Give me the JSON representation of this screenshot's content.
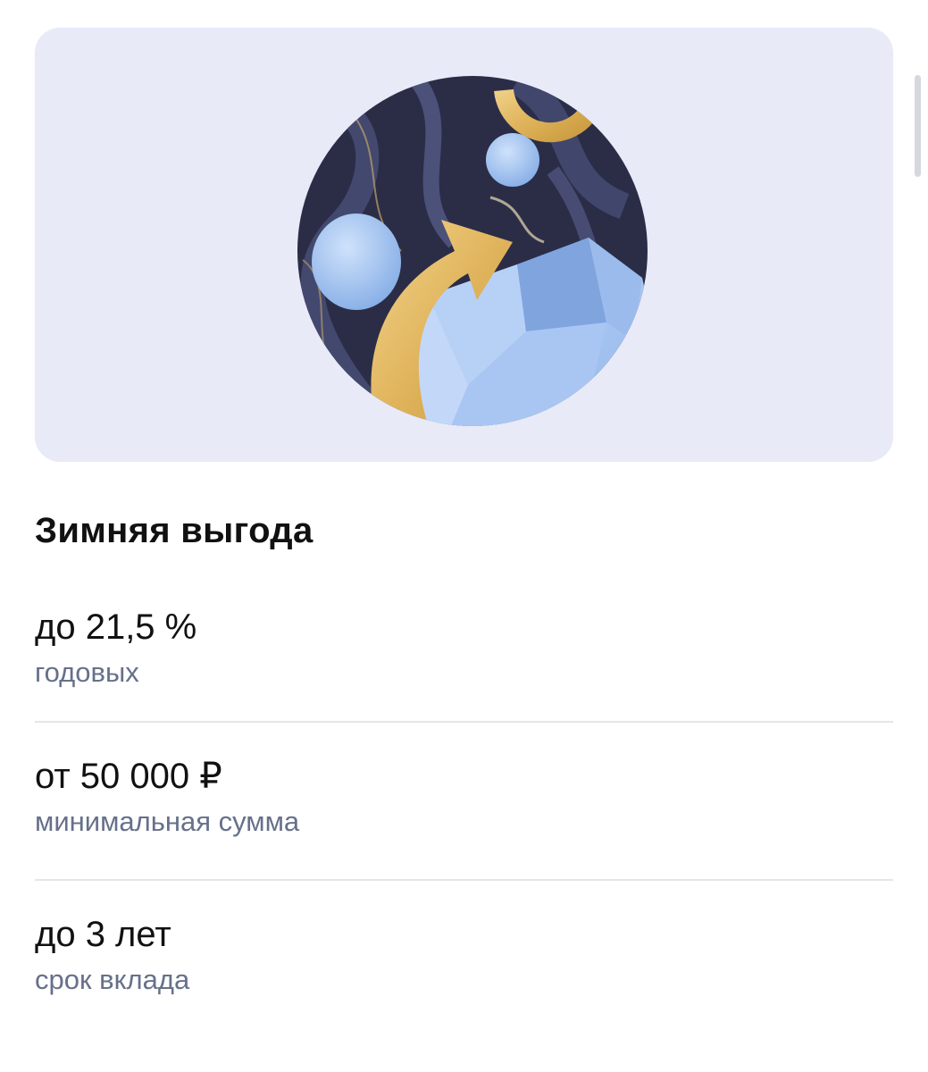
{
  "deposit": {
    "title": "Зимняя выгода",
    "params": [
      {
        "value": "до 21,5 %",
        "caption": "годовых"
      },
      {
        "value": "от 50 000 ₽",
        "caption": "минимальная сумма"
      },
      {
        "value": "до 3 лет",
        "caption": "срок вклада"
      }
    ]
  },
  "colors": {
    "banner_bg": "#e9eaf8",
    "caption_text": "#66708a",
    "title_text": "#111111",
    "gold": "#e2b863",
    "crystal_blue": "#a9c8f2",
    "marble_dark": "#2b2d47"
  }
}
